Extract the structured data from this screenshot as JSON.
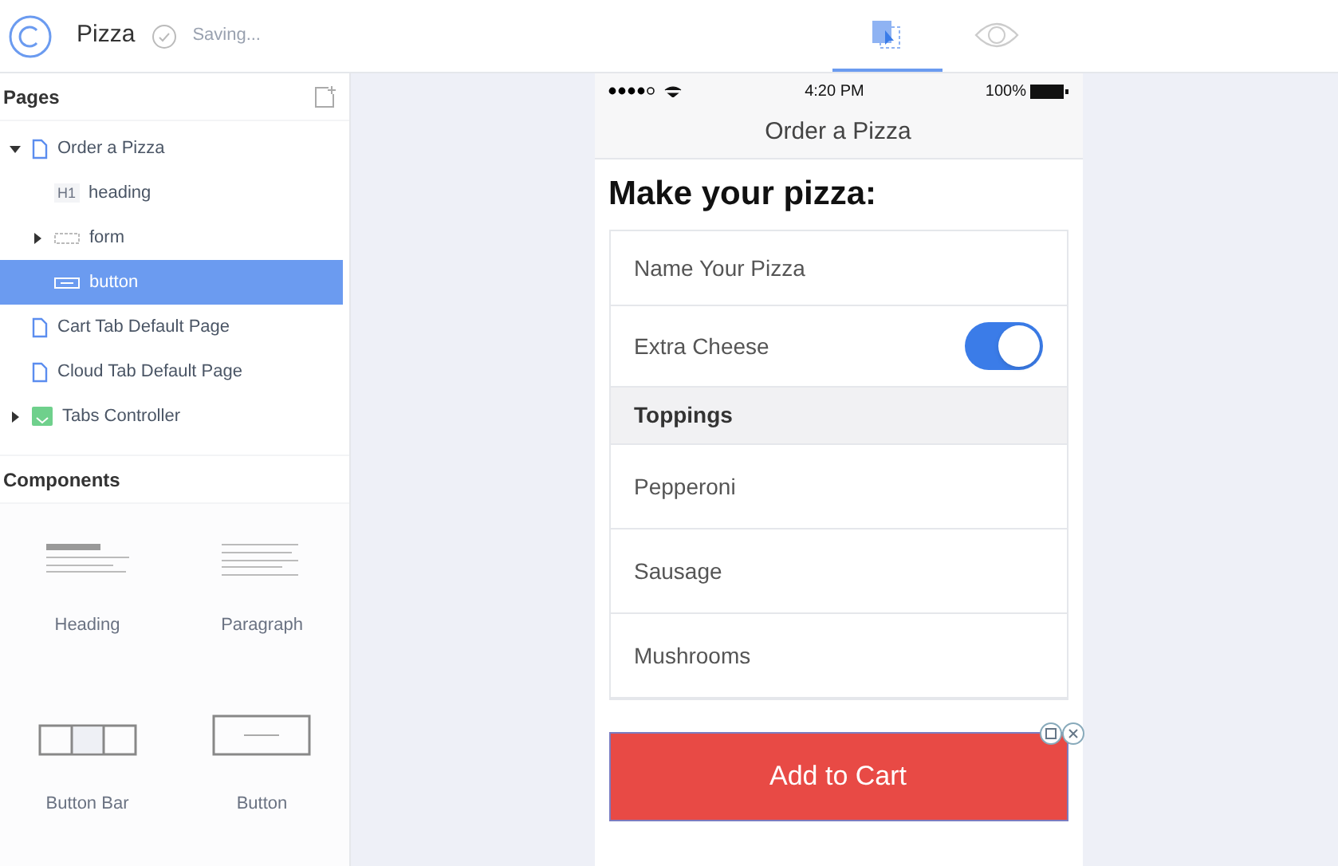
{
  "app": {
    "title": "Pizza",
    "status": "Saving..."
  },
  "view_tabs": [
    {
      "kind": "design",
      "selected": true
    },
    {
      "kind": "preview",
      "selected": false
    }
  ],
  "pages": {
    "title": "Pages",
    "items": [
      {
        "label": "Order a Pizza",
        "kind": "page",
        "expanded": true,
        "selected": false,
        "children": [
          {
            "label": "heading",
            "kind": "h1",
            "badge": "H1",
            "selected": false
          },
          {
            "label": "form",
            "kind": "form",
            "expanded": false,
            "selected": false
          },
          {
            "label": "button",
            "kind": "button",
            "selected": true
          }
        ]
      },
      {
        "label": "Cart Tab Default Page",
        "kind": "page",
        "selected": false
      },
      {
        "label": "Cloud Tab Default Page",
        "kind": "page",
        "selected": false
      },
      {
        "label": "Tabs Controller",
        "kind": "tabs",
        "expanded": false,
        "selected": false
      }
    ]
  },
  "components": {
    "title": "Components",
    "items": [
      {
        "label": "Heading",
        "kind": "heading"
      },
      {
        "label": "Paragraph",
        "kind": "paragraph"
      },
      {
        "label": "Button Bar",
        "kind": "buttonbar"
      },
      {
        "label": "Button",
        "kind": "button"
      }
    ]
  },
  "phone": {
    "status_bar": {
      "time": "4:20 PM",
      "battery": "100%"
    },
    "nav_title": "Order a Pizza",
    "heading": "Make your pizza:",
    "form_rows": [
      {
        "kind": "field",
        "placeholder": "Name Your Pizza"
      },
      {
        "kind": "switch",
        "label": "Extra Cheese",
        "on": true
      },
      {
        "kind": "header",
        "label": "Toppings"
      },
      {
        "kind": "item",
        "label": "Pepperoni"
      },
      {
        "kind": "item",
        "label": "Sausage"
      },
      {
        "kind": "item",
        "label": "Mushrooms"
      }
    ],
    "button": {
      "label": "Add to Cart",
      "selected": true
    }
  }
}
